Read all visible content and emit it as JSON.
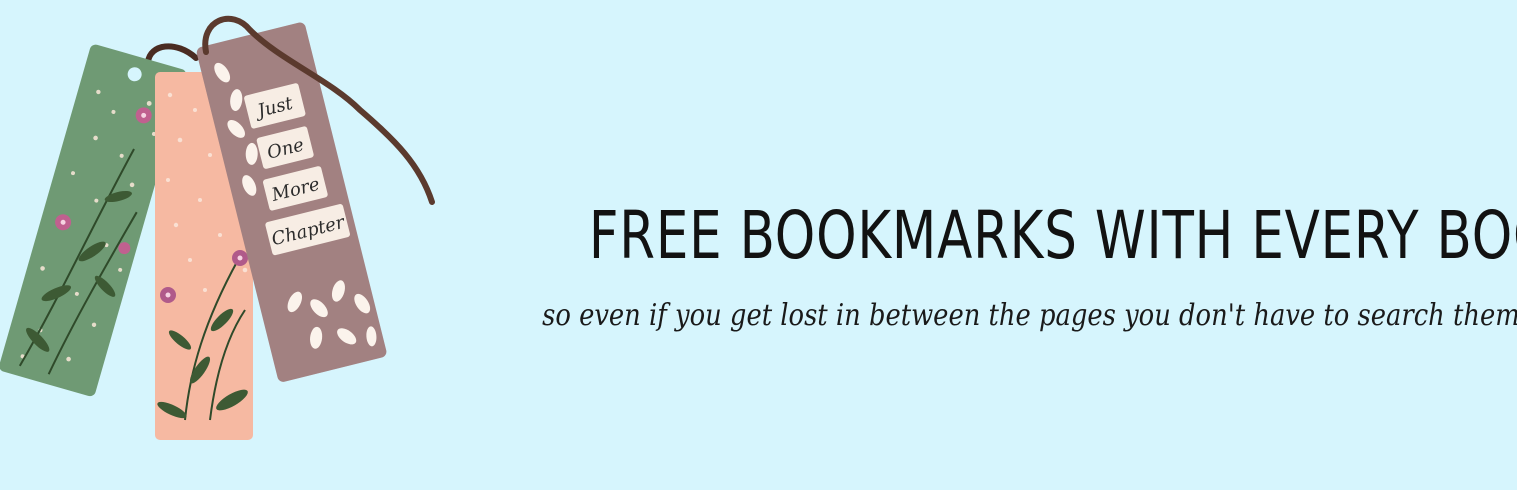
{
  "headline": "FREE BOOKMARKS WITH EVERY BOOK",
  "tagline": "so even if you get lost in between the pages you don't have to search them",
  "bookmark_text": [
    "Just",
    "One",
    "More",
    "Chapter"
  ],
  "colors": {
    "background": "#d6f5fd",
    "green_bookmark": "#6f9a74",
    "peach_bookmark": "#f6b9a2",
    "mauve_bookmark": "#a98787",
    "ribbon": "#5b3a2e",
    "text": "#121212"
  }
}
